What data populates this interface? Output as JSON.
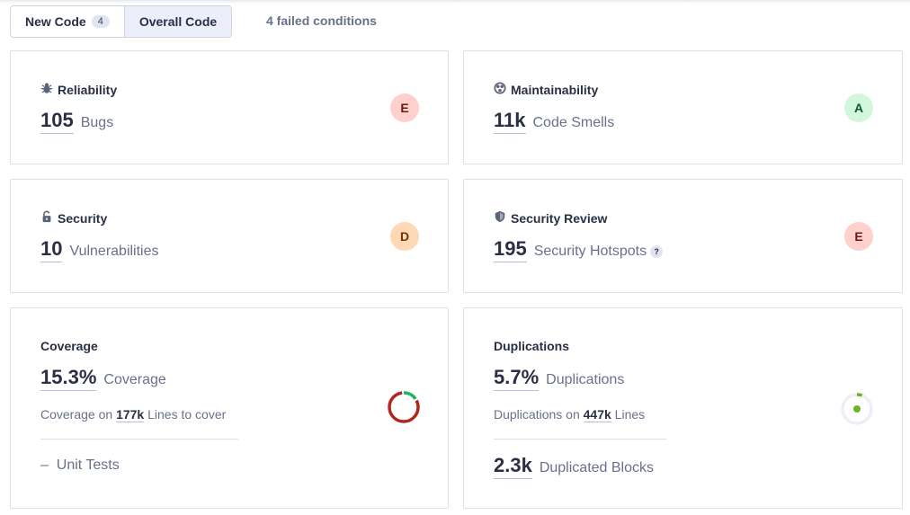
{
  "toggle": {
    "new_code_label": "New Code",
    "new_code_count": "4",
    "overall_code_label": "Overall Code",
    "active": "overall"
  },
  "failed_conditions": "4 failed conditions",
  "cards": {
    "reliability": {
      "title": "Reliability",
      "value": "105",
      "label": "Bugs",
      "rating": "E",
      "rating_bg": "#ffd0cc",
      "rating_fg": "#6a1a12",
      "icon": "bug-icon"
    },
    "maintainability": {
      "title": "Maintainability",
      "value": "11k",
      "label": "Code Smells",
      "rating": "A",
      "rating_bg": "#d2f7dd",
      "rating_fg": "#0c5a2b",
      "icon": "maintainability-icon"
    },
    "security": {
      "title": "Security",
      "value": "10",
      "label": "Vulnerabilities",
      "rating": "D",
      "rating_bg": "#ffd9b5",
      "rating_fg": "#6e3208",
      "icon": "lock-icon"
    },
    "security_review": {
      "title": "Security Review",
      "value": "195",
      "label": "Security Hotspots",
      "help": "?",
      "rating": "E",
      "rating_bg": "#ffd0cc",
      "rating_fg": "#6a1a12",
      "icon": "shield-icon"
    },
    "coverage": {
      "title": "Coverage",
      "value": "15.3%",
      "label": "Coverage",
      "sub_prefix": "Coverage on",
      "sub_value": "177k",
      "sub_suffix": "Lines to cover",
      "unit_tests_value": "–",
      "unit_tests_label": "Unit Tests",
      "percent": 15.3,
      "fill_color": "#1fb35c",
      "rest_color": "#b3261e"
    },
    "duplications": {
      "title": "Duplications",
      "value": "5.7%",
      "label": "Duplications",
      "sub_prefix": "Duplications on",
      "sub_value": "447k",
      "sub_suffix": "Lines",
      "blocks_value": "2.3k",
      "blocks_label": "Duplicated Blocks",
      "percent": 5.7,
      "fill_color": "#6cb624",
      "rest_color": "#eceff6"
    }
  }
}
